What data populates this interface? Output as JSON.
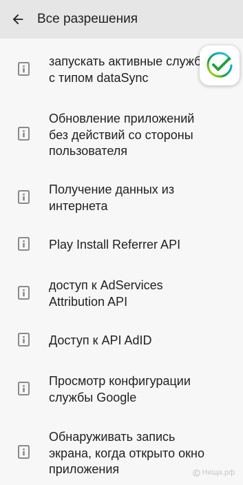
{
  "header": {
    "title": "Все разрешения",
    "back_icon": "arrow-back-icon"
  },
  "permissions": [
    {
      "label": "запускать активные службы\nс типом dataSync",
      "icon": "info-icon"
    },
    {
      "label": "Обновление приложений\nбез действий со стороны\nпользователя",
      "icon": "info-icon"
    },
    {
      "label": "Получение данных из\nинтернета",
      "icon": "info-icon"
    },
    {
      "label": "Play Install Referrer API",
      "icon": "info-icon"
    },
    {
      "label": "доступ к AdServices\nAttribution API",
      "icon": "info-icon"
    },
    {
      "label": "Доступ к API AdID",
      "icon": "info-icon"
    },
    {
      "label": "Просмотр конфигурации\nслужбы Google",
      "icon": "info-icon"
    },
    {
      "label": "Обнаруживать запись\nэкрана, когда открыто окно\nприложения",
      "icon": "info-icon"
    }
  ],
  "overlay": {
    "logo_icon": "sber-logo-icon",
    "watermark": "Нища.рф"
  },
  "colors": {
    "appbar": "#e6e6e6",
    "background": "#f7f7f7",
    "text": "#202124",
    "icon": "#8a8a8a",
    "logo_green": "#21a038",
    "logo_blue": "#42e3b4"
  }
}
